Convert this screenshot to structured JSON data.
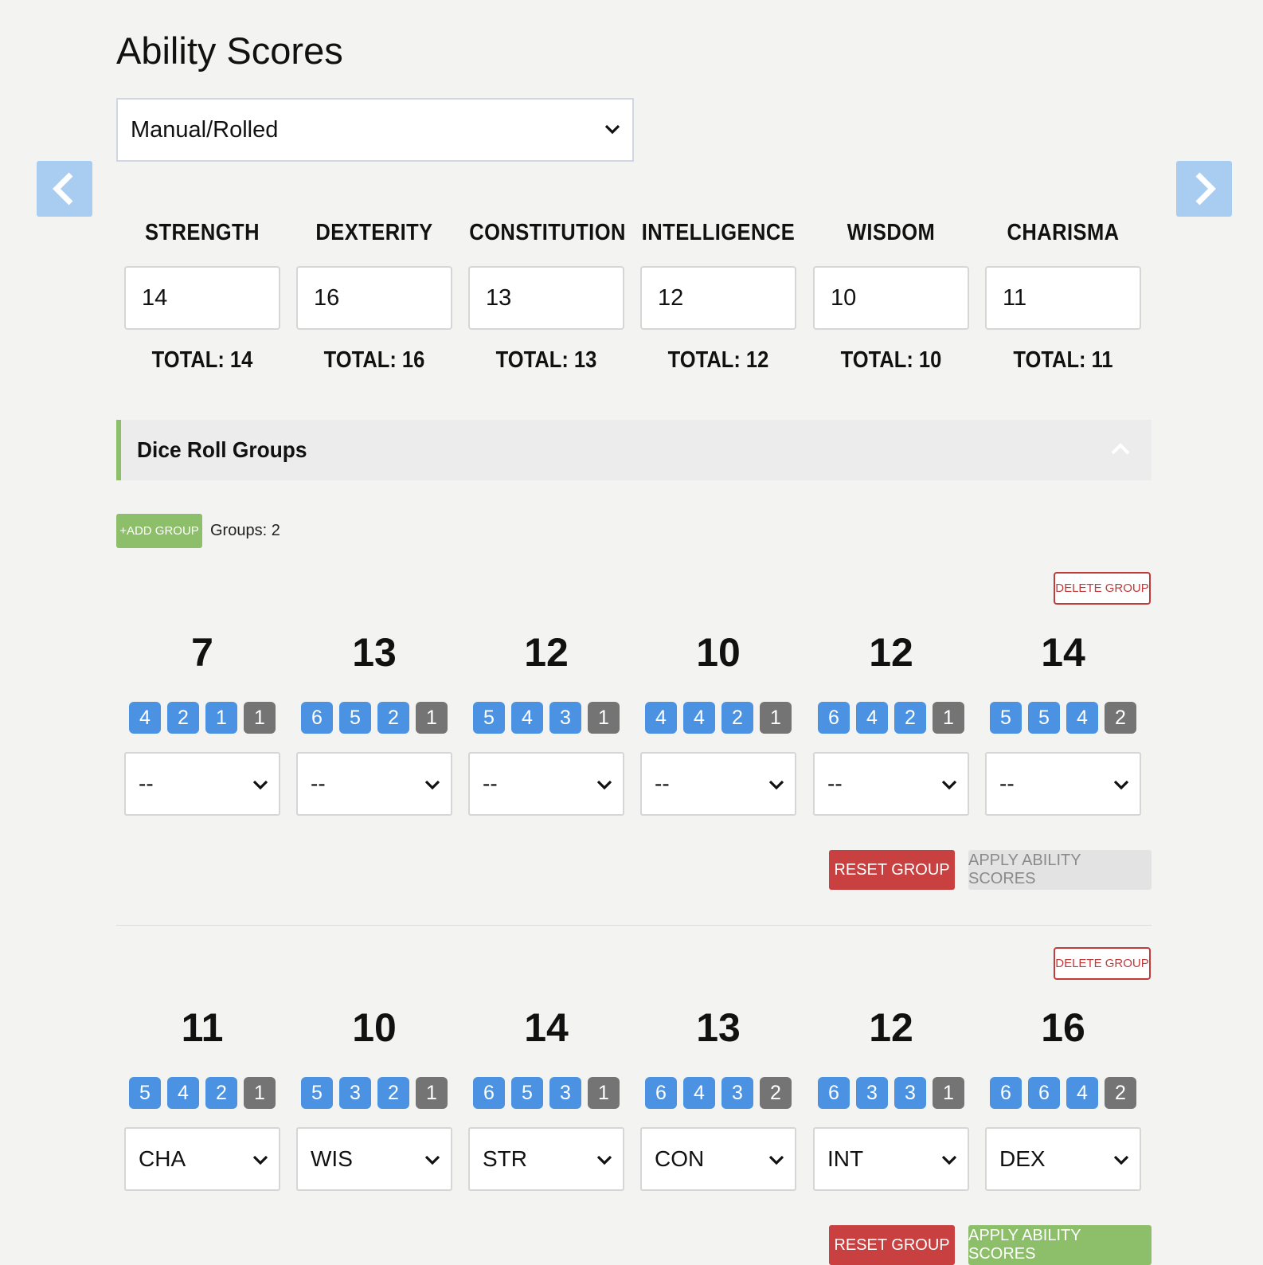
{
  "page": {
    "title": "Ability Scores"
  },
  "method": {
    "selected": "Manual/Rolled"
  },
  "abilities": [
    {
      "name": "STRENGTH",
      "value": "14",
      "total": "TOTAL: 14"
    },
    {
      "name": "DEXTERITY",
      "value": "16",
      "total": "TOTAL: 16"
    },
    {
      "name": "CONSTITUTION",
      "value": "13",
      "total": "TOTAL: 13"
    },
    {
      "name": "INTELLIGENCE",
      "value": "12",
      "total": "TOTAL: 12"
    },
    {
      "name": "WISDOM",
      "value": "10",
      "total": "TOTAL: 10"
    },
    {
      "name": "CHARISMA",
      "value": "11",
      "total": "TOTAL: 11"
    }
  ],
  "dice_section": {
    "title": "Dice Roll Groups",
    "add_group_label": "+ADD GROUP",
    "groups_count": "Groups: 2"
  },
  "groups": [
    {
      "delete_label": "DELETE GROUP",
      "reset_label": "RESET GROUP",
      "apply_label": "APPLY ABILITY SCORES",
      "apply_enabled": false,
      "rolls": [
        {
          "total": "7",
          "dice": [
            "4",
            "2",
            "1",
            "1"
          ],
          "assigned": "--"
        },
        {
          "total": "13",
          "dice": [
            "6",
            "5",
            "2",
            "1"
          ],
          "assigned": "--"
        },
        {
          "total": "12",
          "dice": [
            "5",
            "4",
            "3",
            "1"
          ],
          "assigned": "--"
        },
        {
          "total": "10",
          "dice": [
            "4",
            "4",
            "2",
            "1"
          ],
          "assigned": "--"
        },
        {
          "total": "12",
          "dice": [
            "6",
            "4",
            "2",
            "1"
          ],
          "assigned": "--"
        },
        {
          "total": "14",
          "dice": [
            "5",
            "5",
            "4",
            "2"
          ],
          "assigned": "--"
        }
      ]
    },
    {
      "delete_label": "DELETE GROUP",
      "reset_label": "RESET GROUP",
      "apply_label": "APPLY ABILITY SCORES",
      "apply_enabled": true,
      "rolls": [
        {
          "total": "11",
          "dice": [
            "5",
            "4",
            "2",
            "1"
          ],
          "assigned": "CHA"
        },
        {
          "total": "10",
          "dice": [
            "5",
            "3",
            "2",
            "1"
          ],
          "assigned": "WIS"
        },
        {
          "total": "14",
          "dice": [
            "6",
            "5",
            "3",
            "1"
          ],
          "assigned": "STR"
        },
        {
          "total": "13",
          "dice": [
            "6",
            "4",
            "3",
            "2"
          ],
          "assigned": "CON"
        },
        {
          "total": "12",
          "dice": [
            "6",
            "3",
            "3",
            "1"
          ],
          "assigned": "INT"
        },
        {
          "total": "16",
          "dice": [
            "6",
            "6",
            "4",
            "2"
          ],
          "assigned": "DEX"
        }
      ]
    }
  ],
  "colors": {
    "die_kept": "#4b93e2",
    "die_dropped": "#747474",
    "accent_green": "#8dbf6a",
    "danger_red": "#c94040",
    "nav_arrow": "#a8cdf0"
  },
  "icons": {
    "nav_prev": "chevron-left-icon",
    "nav_next": "chevron-right-icon",
    "select": "chevron-down-icon",
    "collapse": "chevron-up-icon"
  }
}
